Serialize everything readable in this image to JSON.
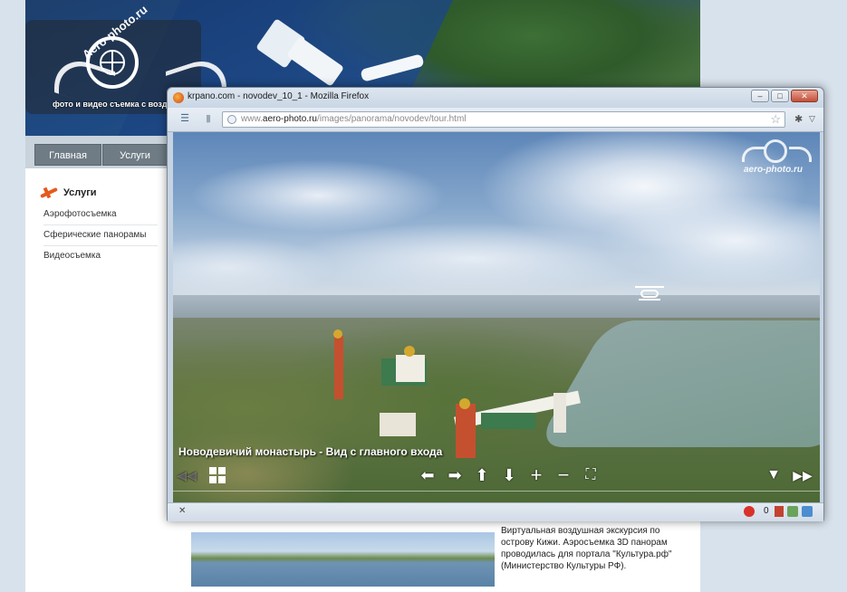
{
  "site": {
    "logo_title": "Aero-photo.ru",
    "logo_subtitle": "фото и видео съемка с воздух",
    "nav": [
      {
        "label": "Главная"
      },
      {
        "label": "Услуги"
      }
    ],
    "sidebar": {
      "heading": "Услуги",
      "items": [
        {
          "label": "Аэрофотосъемка"
        },
        {
          "label": "Сферические панорамы"
        },
        {
          "label": "Видеосъемка"
        }
      ]
    },
    "promo_text": "Виртуальная воздушная экскурсия по острову Кижи. Аэросъемка 3D панорам проводилась для портала \"Культура.рф\"(Министерство Культуры РФ)."
  },
  "browser": {
    "title": "krpano.com - novodev_10_1 - Mozilla Firefox",
    "url_prefix": "www.",
    "url_domain": "aero-photo.ru",
    "url_path": "/images/panorama/novodev/tour.html",
    "window_buttons": {
      "minimize": "–",
      "maximize": "□",
      "close": "✕"
    },
    "status": {
      "close_label": "✕",
      "count": "0"
    }
  },
  "panorama": {
    "caption": "Новодевичий монастырь - Вид с главного входа",
    "watermark": "aero-photo.ru",
    "controls": {
      "prev": "◀◀",
      "left": "⬅",
      "right": "➡",
      "up": "⬆",
      "down": "⬇",
      "zoom_in": "+",
      "zoom_out": "−",
      "fullscreen": "⛶",
      "hide_bar": "▼",
      "next": "▶▶"
    }
  },
  "colors": {
    "accent_orange": "#e55a1d",
    "nav_button": "#6f7c85",
    "window_frame": "#c5d3e2"
  }
}
